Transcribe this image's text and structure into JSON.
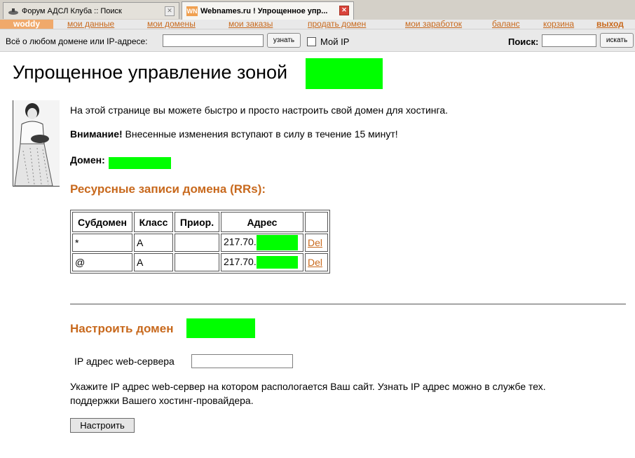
{
  "tabs": [
    {
      "label": "Форум АДСЛ Клуба :: Поиск",
      "icon": "forum-icon",
      "active": false
    },
    {
      "label": "Webnames.ru ! Упрощенное упр...",
      "icon": "webnames-icon",
      "active": true
    }
  ],
  "nav": {
    "user": "woddy",
    "links": [
      "мои данные",
      "мои домены",
      "мои заказы",
      "продать домен",
      "мои заработок",
      "баланс",
      "корзина",
      "выход"
    ]
  },
  "search": {
    "domain_label": "Всё о любом домене или IP-адресе:",
    "domain_value": "",
    "domain_button": "узнать",
    "myip_label": "Мой IP",
    "search_label": "Поиск:",
    "search_value": "",
    "search_button": "искать"
  },
  "page": {
    "title": "Упрощенное управление зоной",
    "intro": "На этой странице вы можете быстро и просто настроить свой домен для хостинга.",
    "warning_bold": "Внимание!",
    "warning_text": " Внесенные изменения вступают в силу в течение 15 минут!",
    "domain_label": "Домен:",
    "rr_heading": "Ресурсные записи домена (RRs):"
  },
  "rr_table": {
    "headers": [
      "Субдомен",
      "Класс",
      "Приор.",
      "Адрес",
      ""
    ],
    "rows": [
      {
        "subdomain": "*",
        "class": "A",
        "priority": "",
        "address": "217.70.",
        "action": "Del"
      },
      {
        "subdomain": "@",
        "class": "A",
        "priority": "",
        "address": "217.70.",
        "action": "Del"
      }
    ]
  },
  "setup": {
    "heading": "Настроить домен",
    "ip_label": "IP адрес web-сервера",
    "ip_value": "",
    "help_line1": "Укажите IP адрес web-сервер на котором распологается Ваш сайт. Узнать IP адрес можно в службе тех.",
    "help_line2": "поддержки Вашего хостинг-провайдера.",
    "button": "Настроить"
  },
  "colors": {
    "accent_orange": "#c8691d",
    "redaction_green": "#00ff00",
    "nav_user_bg": "#f0a96b"
  }
}
